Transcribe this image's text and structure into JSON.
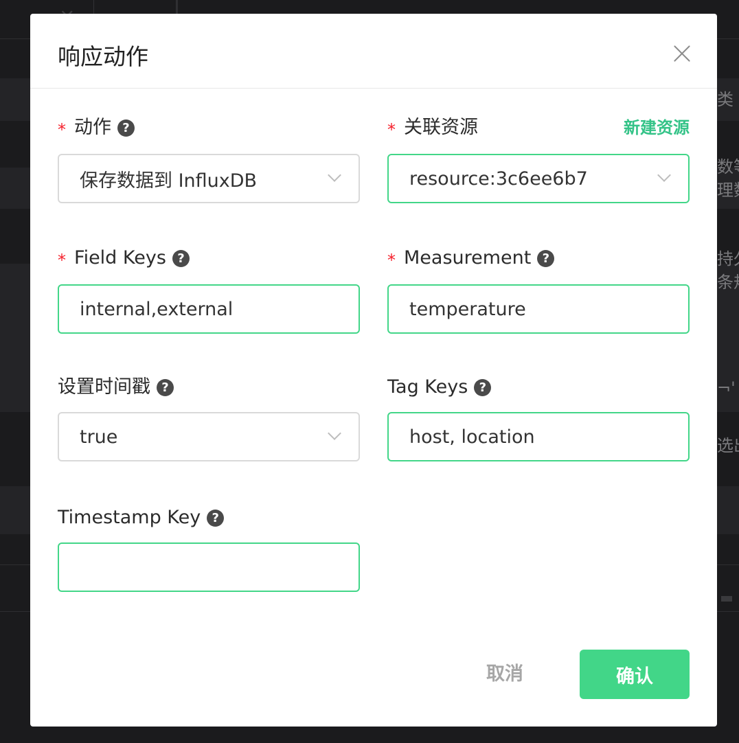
{
  "background": {
    "side_texts": [
      "类",
      "数等",
      "理数",
      "持久",
      "条规",
      "¬'",
      "选出"
    ]
  },
  "modal": {
    "title": "响应动作",
    "fields": {
      "action": {
        "label": "动作",
        "value": "保存数据到 InfluxDB",
        "required": true,
        "help_icon": "question-circle-icon"
      },
      "resource": {
        "label": "关联资源",
        "value": "resource:3c6ee6b7",
        "required": true,
        "link": "新建资源"
      },
      "field_keys": {
        "label": "Field Keys",
        "value": "internal,external",
        "required": true,
        "help_icon": "question-circle-icon"
      },
      "measurement": {
        "label": "Measurement",
        "value": "temperature",
        "required": true,
        "help_icon": "question-circle-icon"
      },
      "set_timestamp": {
        "label": "设置时间戳",
        "value": "true",
        "required": false,
        "help_icon": "question-circle-icon"
      },
      "tag_keys": {
        "label": "Tag Keys",
        "value": "host, location",
        "required": false,
        "help_icon": "question-circle-icon"
      },
      "timestamp_key": {
        "label": "Timestamp Key",
        "value": "",
        "required": false,
        "help_icon": "question-circle-icon"
      }
    },
    "required_mark": "*",
    "help_glyph": "?",
    "footer": {
      "cancel": "取消",
      "confirm": "确认"
    }
  },
  "colors": {
    "accent": "#42d688",
    "required": "#f5222d",
    "link": "#34c388"
  }
}
